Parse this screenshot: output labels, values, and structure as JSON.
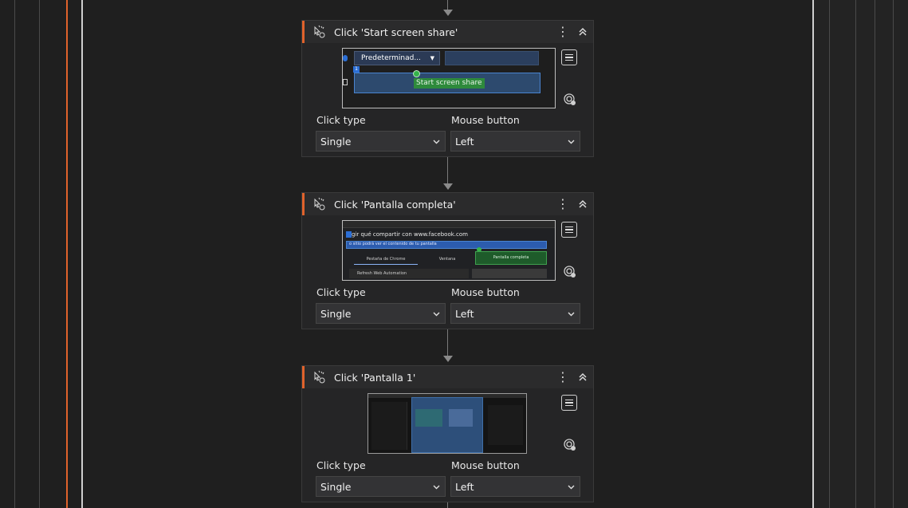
{
  "labels": {
    "click_type": "Click type",
    "mouse_button": "Mouse button"
  },
  "cards": [
    {
      "title": "Click 'Start screen share'",
      "click_type": "Single",
      "mouse_button": "Left",
      "thumbnail": {
        "dropdown_label": "Predeterminad...",
        "button_label": "Start screen share"
      }
    },
    {
      "title": "Click 'Pantalla completa'",
      "click_type": "Single",
      "mouse_button": "Left",
      "thumbnail": {
        "heading": "gir qué compartir con www.facebook.com",
        "subheading": "o sitio podrá ver el contenido de tu pantalla",
        "tab_chrome": "Pestaña de Chrome",
        "tab_window": "Ventana",
        "tab_full": "Pantalla completa",
        "list_item": "Refresh Web Automation"
      }
    },
    {
      "title": "Click 'Pantalla 1'",
      "click_type": "Single",
      "mouse_button": "Left",
      "thumbnail": {}
    }
  ],
  "icons": {
    "action": "mouse-click-icon",
    "menu": "more-vertical-icon",
    "collapse": "chevrons-up-icon",
    "details": "list-icon",
    "target": "target-icon",
    "dropdown": "chevron-down-icon"
  },
  "colors": {
    "accent": "#e0622b",
    "background": "#1f1f1f",
    "card": "#252526"
  }
}
